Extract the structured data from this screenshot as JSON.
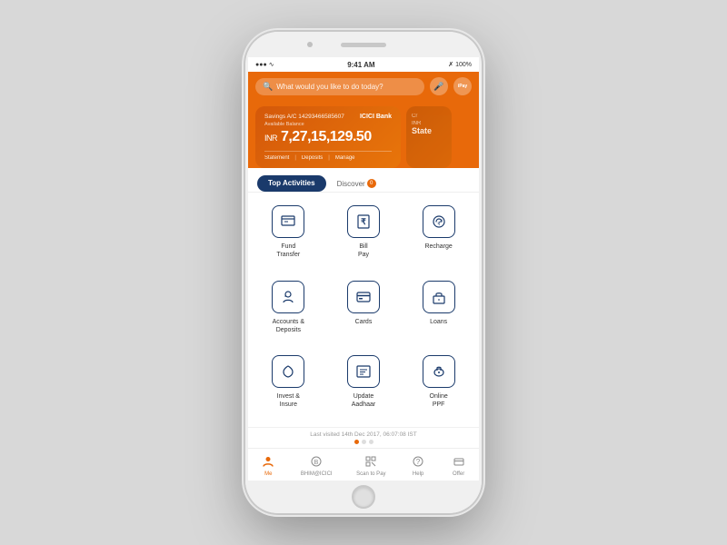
{
  "status_bar": {
    "time": "9:41 AM",
    "signal": "●●●",
    "wifi": "wifi",
    "bluetooth": "bluetooth",
    "battery": "100%"
  },
  "search_bar": {
    "placeholder": "What would you like to do today?",
    "mic_label": "mic",
    "pay_label": "iPay"
  },
  "card": {
    "type": "Savings A/C",
    "account_number": "14293466585607",
    "balance_label": "Available Balance",
    "currency": "INR",
    "balance": "7,27,15,129.50",
    "actions": [
      "Statement",
      "Deposits",
      "Manage"
    ]
  },
  "card_partial": {
    "type": "Cr",
    "label": "INR",
    "state_label": "State"
  },
  "tabs": {
    "active": "Top Activities",
    "inactive": "Discover",
    "discover_count": "0"
  },
  "activities": [
    {
      "icon": "📋",
      "label": "Fund\nTransfer",
      "id": "fund-transfer"
    },
    {
      "icon": "₹",
      "label": "Bill\nPay",
      "id": "bill-pay"
    },
    {
      "icon": "↻",
      "label": "Recharge",
      "id": "recharge"
    },
    {
      "icon": "🏦",
      "label": "Accounts &\nDeposits",
      "id": "accounts-deposits"
    },
    {
      "icon": "💳",
      "label": "Cards",
      "id": "cards"
    },
    {
      "icon": "🏠",
      "label": "Loans",
      "id": "loans"
    },
    {
      "icon": "☂",
      "label": "Invest &\nInsure",
      "id": "invest-insure"
    },
    {
      "icon": "📝",
      "label": "Update\nAadhaar",
      "id": "update-aadhaar"
    },
    {
      "icon": "🐷",
      "label": "Online\nPPF",
      "id": "online-ppf"
    }
  ],
  "last_visited": "Last visited 14th Dec 2017, 06:07:08 IST",
  "bottom_nav": [
    {
      "icon": "👤",
      "label": "Me",
      "active": true,
      "id": "me"
    },
    {
      "icon": "₿",
      "label": "BHIM@ICICI",
      "active": false,
      "id": "bhim"
    },
    {
      "icon": "📱",
      "label": "Scan to Pay",
      "active": false,
      "id": "scan-to-pay"
    },
    {
      "icon": "?",
      "label": "Help",
      "active": false,
      "id": "help"
    },
    {
      "icon": "🏷",
      "label": "Offer",
      "active": false,
      "id": "offer"
    }
  ]
}
